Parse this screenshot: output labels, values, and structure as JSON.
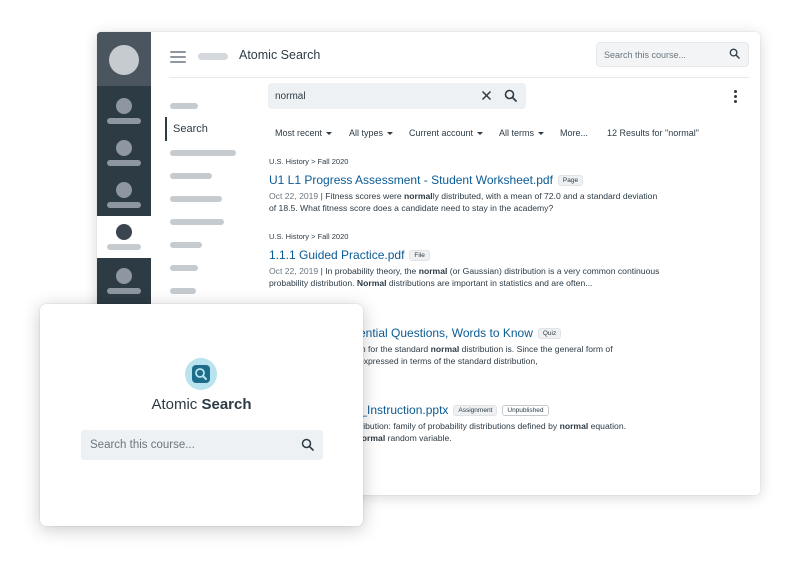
{
  "app": {
    "title": "Atomic Search"
  },
  "header": {
    "search_placeholder": "Search this course..."
  },
  "course_nav": {
    "active_label": "Search"
  },
  "search": {
    "query": "normal"
  },
  "filters": [
    {
      "label": "Most recent"
    },
    {
      "label": "All types"
    },
    {
      "label": "Current account"
    },
    {
      "label": "All terms"
    },
    {
      "label": "More..."
    }
  ],
  "results_count": "12 Results for \"normal\"",
  "results": [
    {
      "crumb": "U.S. History > Fall 2020",
      "title": "U1 L1 Progress Assessment - Student Worksheet.pdf",
      "badges": [
        "Page"
      ],
      "date": "Oct 22, 2019",
      "snippet_1": "Fitness scores were ",
      "snippet_b1": "normal",
      "snippet_2": "ly distributed, with a mean of 72.0 and a standard deviation of 18.5. What fitness score does a candidate need to stay in the academy?"
    },
    {
      "crumb": "U.S. History > Fall 2020",
      "title": "1.1.1 Guided Practice.pdf",
      "badges": [
        "File"
      ],
      "date": "Oct 22, 2019",
      "snippet_1": "In probability theory, the ",
      "snippet_b1": "normal",
      "snippet_2": " (or Gaussian) distribution is a very common continuous probability distribution. ",
      "snippet_b2": "Normal",
      "snippet_3": " distributions are important in statistics and are often..."
    },
    {
      "title_visible": "ssential Questions, Words to Know",
      "badges": [
        "Quiz"
      ],
      "line_1a": "ation for the standard ",
      "line_1b": "normal",
      "line_1c": " distribution is. Since the general form of",
      "line_2": "be expressed in terms of the standard distribution,"
    },
    {
      "title_visible": "ed_Instruction.pptx",
      "badges": [
        "Assignment",
        "Unpublished"
      ],
      "line_1a": "distribution: family of probability distributions defined by ",
      "line_1b": "normal",
      "line_1c": " equation.",
      "line_2a": "of ",
      "line_2b": "normal",
      "line_2c": " random variable."
    }
  ],
  "overlay": {
    "title_regular": "Atomic ",
    "title_bold": "Search",
    "search_placeholder": "Search this course..."
  },
  "colors": {
    "nav_dark": "#2d3b45",
    "link": "#0b5b94",
    "logo_bg": "#b9e3ef",
    "logo_fg": "#1d6d8a"
  }
}
